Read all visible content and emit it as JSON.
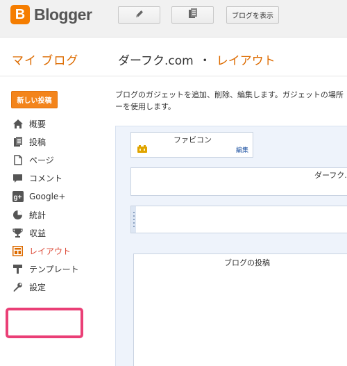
{
  "app": {
    "brand": "Blogger",
    "accent_color": "#f57d00"
  },
  "toolbar": {
    "edit_icon": "pencil-icon",
    "posts_icon": "document-list-icon",
    "view_blog_label": "ブログを表示"
  },
  "header": {
    "my_blog": "マイ ブログ",
    "blog_name": "ダーフク.com",
    "separator": "・",
    "section": "レイアウト"
  },
  "sidebar": {
    "new_post_label": "新しい投稿",
    "items": [
      {
        "label": "概要",
        "icon": "home-icon"
      },
      {
        "label": "投稿",
        "icon": "posts-icon"
      },
      {
        "label": "ページ",
        "icon": "page-icon"
      },
      {
        "label": "コメント",
        "icon": "comment-icon"
      },
      {
        "label": "Google+",
        "icon": "google-plus-icon"
      },
      {
        "label": "統計",
        "icon": "stats-pie-icon"
      },
      {
        "label": "収益",
        "icon": "trophy-icon"
      },
      {
        "label": "レイアウト",
        "icon": "layout-icon",
        "active": true
      },
      {
        "label": "テンプレート",
        "icon": "template-icon"
      },
      {
        "label": "設定",
        "icon": "wrench-icon"
      }
    ],
    "highlight_color": "#ea3f76"
  },
  "main": {
    "description_line1": "ブログのガジェットを追加、削除、編集します。ガジェットの場所",
    "description_line2": "ーを使用します。",
    "gadgets": {
      "favicon_title": "ファビコン",
      "favicon_edit": "編集",
      "header_title": "ダーフク.",
      "posts_title": "ブログの投稿"
    }
  }
}
